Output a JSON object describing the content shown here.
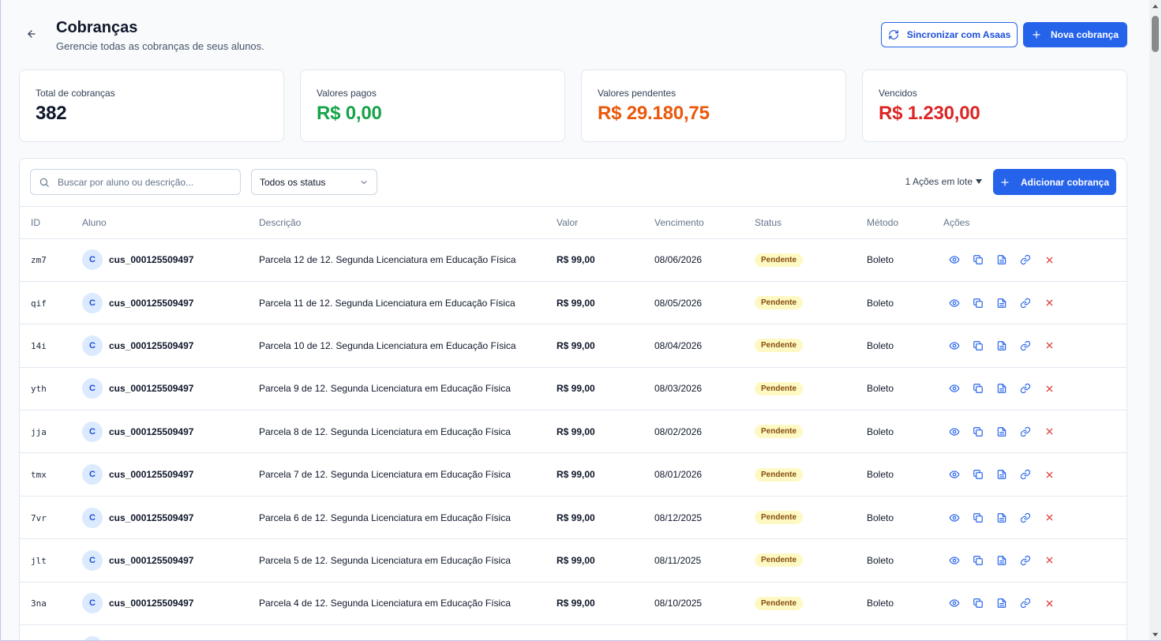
{
  "header": {
    "title": "Cobranças",
    "subtitle": "Gerencie todas as cobranças de seus alunos.",
    "sync_label": "Sincronizar com Asaas",
    "new_label": "Nova cobrança"
  },
  "stats": [
    {
      "label": "Total de cobranças",
      "value": "382",
      "color": "#0f172a"
    },
    {
      "label": "Valores pagos",
      "value": "R$ 0,00",
      "color": "#16a34a"
    },
    {
      "label": "Valores pendentes",
      "value": "R$ 29.180,75",
      "color": "#ea580c"
    },
    {
      "label": "Vencidos",
      "value": "R$ 1.230,00",
      "color": "#dc2626"
    }
  ],
  "toolbar": {
    "search_placeholder": "Buscar por aluno ou descrição...",
    "status_filter": "Todos os status",
    "batch_label": "1 Ações em lote",
    "add_label": "Adicionar cobrança"
  },
  "table": {
    "headers": [
      "ID",
      "Aluno",
      "Descrição",
      "Valor",
      "Vencimento",
      "Status",
      "Método",
      "Ações"
    ],
    "rows": [
      {
        "id": "zm7",
        "avatar": "C",
        "aluno": "cus_000125509497",
        "descricao": "Parcela 12 de 12. Segunda Licenciatura em Educação Física",
        "valor": "R$ 99,00",
        "vencimento": "08/06/2026",
        "status": "Pendente",
        "metodo": "Boleto"
      },
      {
        "id": "qif",
        "avatar": "C",
        "aluno": "cus_000125509497",
        "descricao": "Parcela 11 de 12. Segunda Licenciatura em Educação Física",
        "valor": "R$ 99,00",
        "vencimento": "08/05/2026",
        "status": "Pendente",
        "metodo": "Boleto"
      },
      {
        "id": "14i",
        "avatar": "C",
        "aluno": "cus_000125509497",
        "descricao": "Parcela 10 de 12. Segunda Licenciatura em Educação Física",
        "valor": "R$ 99,00",
        "vencimento": "08/04/2026",
        "status": "Pendente",
        "metodo": "Boleto"
      },
      {
        "id": "yth",
        "avatar": "C",
        "aluno": "cus_000125509497",
        "descricao": "Parcela 9 de 12. Segunda Licenciatura em Educação Física",
        "valor": "R$ 99,00",
        "vencimento": "08/03/2026",
        "status": "Pendente",
        "metodo": "Boleto"
      },
      {
        "id": "jja",
        "avatar": "C",
        "aluno": "cus_000125509497",
        "descricao": "Parcela 8 de 12. Segunda Licenciatura em Educação Física",
        "valor": "R$ 99,00",
        "vencimento": "08/02/2026",
        "status": "Pendente",
        "metodo": "Boleto"
      },
      {
        "id": "tmx",
        "avatar": "C",
        "aluno": "cus_000125509497",
        "descricao": "Parcela 7 de 12. Segunda Licenciatura em Educação Física",
        "valor": "R$ 99,00",
        "vencimento": "08/01/2026",
        "status": "Pendente",
        "metodo": "Boleto"
      },
      {
        "id": "7vr",
        "avatar": "C",
        "aluno": "cus_000125509497",
        "descricao": "Parcela 6 de 12. Segunda Licenciatura em Educação Física",
        "valor": "R$ 99,00",
        "vencimento": "08/12/2025",
        "status": "Pendente",
        "metodo": "Boleto"
      },
      {
        "id": "jlt",
        "avatar": "C",
        "aluno": "cus_000125509497",
        "descricao": "Parcela 5 de 12. Segunda Licenciatura em Educação Física",
        "valor": "R$ 99,00",
        "vencimento": "08/11/2025",
        "status": "Pendente",
        "metodo": "Boleto"
      },
      {
        "id": "3na",
        "avatar": "C",
        "aluno": "cus_000125509497",
        "descricao": "Parcela 4 de 12. Segunda Licenciatura em Educação Física",
        "valor": "R$ 99,00",
        "vencimento": "08/10/2025",
        "status": "Pendente",
        "metodo": "Boleto"
      },
      {
        "id": "",
        "avatar": "C",
        "aluno": "",
        "descricao": "",
        "valor": "",
        "vencimento": "",
        "status": "",
        "metodo": ""
      }
    ]
  },
  "icons": {
    "back": "arrow-left-icon",
    "sync": "refresh-icon",
    "plus": "plus-icon",
    "search": "search-icon",
    "chevron": "chevron-down-icon",
    "caret": "caret-down-icon",
    "row_actions": [
      "eye-icon",
      "copy-icon",
      "file-text-icon",
      "link-icon",
      "close-icon"
    ]
  },
  "colors": {
    "primary": "#2563eb",
    "paid": "#16a34a",
    "pending": "#ea580c",
    "overdue": "#dc2626",
    "badge_bg": "#fef9c3",
    "badge_text": "#854d0e"
  }
}
